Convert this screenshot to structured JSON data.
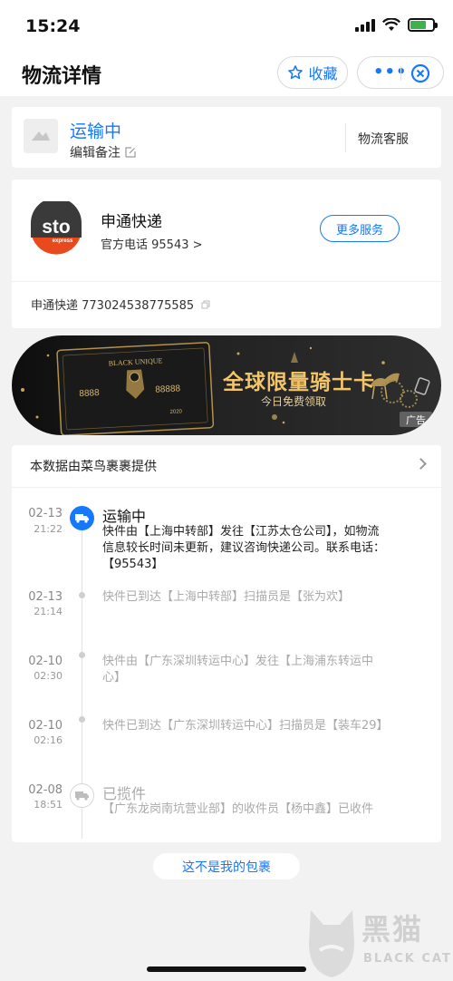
{
  "status_bar": {
    "time": "15:24"
  },
  "nav": {
    "title": "物流详情",
    "favorite_label": "收藏",
    "more_dots": "•••"
  },
  "status_card": {
    "status": "运输中",
    "edit_note": "编辑备注",
    "customer_service": "物流客服"
  },
  "courier": {
    "logo_text": "sto",
    "logo_subtext": "express",
    "name": "申通快递",
    "phone_label": "官方电话 95543 >",
    "more_service": "更多服务",
    "tracking_line": "申通快递 773024538775585"
  },
  "ad": {
    "title": "全球限量骑士卡",
    "subtitle": "今日免费领取",
    "label": "广告",
    "card_brand": "BLACK UNIQUE",
    "card_number_left": "8888",
    "card_number_right": "88888",
    "card_year": "2020"
  },
  "timeline": {
    "provider": "本数据由菜鸟裹裹提供",
    "events": [
      {
        "date": "02-13",
        "time": "21:22",
        "status": "运输中",
        "lines": [
          "快件由【上海中转部】发往【江苏太仓公司】，如物流",
          "信息较长时间未更新，建议咨询快递公司。联系电话：",
          "【95543】"
        ],
        "active": true
      },
      {
        "date": "02-13",
        "time": "21:14",
        "status": "",
        "lines": [
          "快件已到达【上海中转部】扫描员是【张为欢】"
        ],
        "active": false
      },
      {
        "date": "02-10",
        "time": "02:30",
        "status": "",
        "lines": [
          "快件由【广东深圳转运中心】发往【上海浦东转运中",
          "心】"
        ],
        "active": false
      },
      {
        "date": "02-10",
        "time": "02:16",
        "status": "",
        "lines": [
          "快件已到达【广东深圳转运中心】扫描员是【装车29】"
        ],
        "active": false
      },
      {
        "date": "02-08",
        "time": "18:51",
        "status": "已揽件",
        "lines": [
          "【广东龙岗南坑营业部】的收件员【杨中鑫】已收件"
        ],
        "active": false
      }
    ]
  },
  "footer": {
    "not_mine": "这不是我的包裹"
  },
  "watermark": {
    "big": "黑猫",
    "small": "BLACK CAT"
  },
  "colors": {
    "accent": "#1677ff",
    "background": "#f2f2f2",
    "ad_gold": "#f2c56b"
  }
}
